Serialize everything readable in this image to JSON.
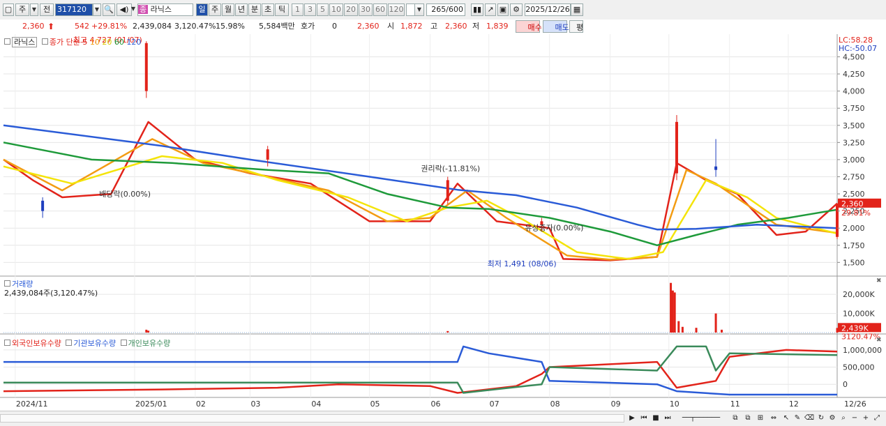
{
  "toolbar": {
    "period_tabs": [
      "주",
      "전"
    ],
    "code": "317120",
    "stock_badge": "종",
    "stock_name": "라닉스",
    "periods": [
      "일",
      "주",
      "월",
      "년",
      "분",
      "초",
      "틱"
    ],
    "active_period": "일",
    "minute_options": [
      "1",
      "3",
      "5",
      "10",
      "20",
      "30",
      "60",
      "120"
    ],
    "count": "265",
    "count_total": "/600",
    "date": "2025/12/26"
  },
  "price_row": {
    "price": "2,360",
    "change": "542",
    "change_pct": "+29.81%",
    "volume": "2,439,084",
    "volume_pct": "3,120.47%",
    "turnover": "15.98%",
    "amount": "5,584백만",
    "quote_label": "호가",
    "quote_value": "0",
    "quote_price": "2,360",
    "open_label": "시",
    "open": "1,872",
    "high_label": "고",
    "high": "2,360",
    "low_label": "저",
    "low": "1,839",
    "buy_label": "매수",
    "sell_label": "매도",
    "extra_label": "평"
  },
  "legend": {
    "stock_name": "라닉스",
    "price_type": "종가 단순",
    "ma_periods": [
      "5",
      "10",
      "20",
      "60",
      "120"
    ],
    "ma_colors": [
      "#e2231a",
      "#f39c12",
      "#f4e40a",
      "#1e9a3a",
      "#2a5bd7"
    ]
  },
  "chart_data": [
    {
      "type": "line",
      "title": "",
      "y_ticks": [
        "4,500",
        "4,250",
        "4,000",
        "3,750",
        "3,500",
        "3,250",
        "3,000",
        "2,750",
        "2,500",
        "2,250",
        "2,000",
        "1,750",
        "1,500"
      ],
      "ylim": [
        1300,
        4800
      ],
      "x_ticks": [
        "2024/11",
        "2025/01",
        "02",
        "03",
        "04",
        "05",
        "06",
        "07",
        "08",
        "09",
        "10",
        "11",
        "12",
        "12/26"
      ],
      "top_right_labels": [
        "LC:58.28",
        "HC:-50.07"
      ],
      "last_price_label": "2,360",
      "last_change_label": "29.81%",
      "annotations": [
        {
          "text": "최고 4,727 (01/07)",
          "x": "2025/01/07",
          "y": 4727
        },
        {
          "text": "배당락(0.00%)",
          "x": "2024/12/26",
          "y": 2380
        },
        {
          "text": "권리락(-11.81%)",
          "x": "2025/06/10",
          "y": 2750
        },
        {
          "text": "유상증자(0.00%)",
          "x": "2025/07/28",
          "y": 2050
        },
        {
          "text": "최저 1,491 (08/06)",
          "x": "2025/08/06",
          "y": 1491
        }
      ],
      "series": [
        {
          "name": "5",
          "color": "#e2231a",
          "points": [
            [
              "2024-10-26",
              3000
            ],
            [
              "2024-11-10",
              2700
            ],
            [
              "2024-11-25",
              2450
            ],
            [
              "2024-12-20",
              2500
            ],
            [
              "2025-01-08",
              3550
            ],
            [
              "2025-02-01",
              3000
            ],
            [
              "2025-03-01",
              2800
            ],
            [
              "2025-04-01",
              2650
            ],
            [
              "2025-05-01",
              2100
            ],
            [
              "2025-06-01",
              2100
            ],
            [
              "2025-06-15",
              2650
            ],
            [
              "2025-07-05",
              2100
            ],
            [
              "2025-08-01",
              2000
            ],
            [
              "2025-08-08",
              1550
            ],
            [
              "2025-09-01",
              1530
            ],
            [
              "2025-09-25",
              1580
            ],
            [
              "2025-10-05",
              2950
            ],
            [
              "2025-10-20",
              2700
            ],
            [
              "2025-11-05",
              2500
            ],
            [
              "2025-11-25",
              1900
            ],
            [
              "2025-12-10",
              1950
            ],
            [
              "2025-12-26",
              2360
            ]
          ]
        },
        {
          "name": "10",
          "color": "#f39c12",
          "points": [
            [
              "2024-10-26",
              3000
            ],
            [
              "2024-11-25",
              2550
            ],
            [
              "2025-01-10",
              3300
            ],
            [
              "2025-02-05",
              2950
            ],
            [
              "2025-03-10",
              2750
            ],
            [
              "2025-04-10",
              2550
            ],
            [
              "2025-05-10",
              2100
            ],
            [
              "2025-06-01",
              2150
            ],
            [
              "2025-06-20",
              2550
            ],
            [
              "2025-07-10",
              2150
            ],
            [
              "2025-08-10",
              1600
            ],
            [
              "2025-09-01",
              1540
            ],
            [
              "2025-09-25",
              1580
            ],
            [
              "2025-10-10",
              2850
            ],
            [
              "2025-10-25",
              2650
            ],
            [
              "2025-11-25",
              2050
            ],
            [
              "2025-12-26",
              1930
            ]
          ]
        },
        {
          "name": "20",
          "color": "#f4e40a",
          "points": [
            [
              "2024-10-26",
              2900
            ],
            [
              "2024-11-30",
              2650
            ],
            [
              "2025-01-15",
              3050
            ],
            [
              "2025-02-15",
              2950
            ],
            [
              "2025-03-15",
              2700
            ],
            [
              "2025-04-20",
              2450
            ],
            [
              "2025-05-20",
              2100
            ],
            [
              "2025-06-10",
              2300
            ],
            [
              "2025-06-30",
              2400
            ],
            [
              "2025-07-20",
              2100
            ],
            [
              "2025-08-15",
              1650
            ],
            [
              "2025-09-10",
              1550
            ],
            [
              "2025-09-28",
              1650
            ],
            [
              "2025-10-20",
              2700
            ],
            [
              "2025-11-10",
              2450
            ],
            [
              "2025-11-25",
              2150
            ],
            [
              "2025-12-26",
              1920
            ]
          ]
        },
        {
          "name": "60",
          "color": "#1e9a3a",
          "points": [
            [
              "2024-10-26",
              3250
            ],
            [
              "2024-12-10",
              3000
            ],
            [
              "2025-01-20",
              2950
            ],
            [
              "2025-03-10",
              2850
            ],
            [
              "2025-04-10",
              2800
            ],
            [
              "2025-05-10",
              2500
            ],
            [
              "2025-06-10",
              2300
            ],
            [
              "2025-07-01",
              2280
            ],
            [
              "2025-08-01",
              2150
            ],
            [
              "2025-09-01",
              1950
            ],
            [
              "2025-09-25",
              1750
            ],
            [
              "2025-10-15",
              1900
            ],
            [
              "2025-11-05",
              2050
            ],
            [
              "2025-12-01",
              2150
            ],
            [
              "2025-12-26",
              2270
            ]
          ]
        },
        {
          "name": "120",
          "color": "#2a5bd7",
          "points": [
            [
              "2024-10-26",
              3500
            ],
            [
              "2025-01-15",
              3200
            ],
            [
              "2025-03-01",
              3000
            ],
            [
              "2025-05-01",
              2750
            ],
            [
              "2025-06-15",
              2560
            ],
            [
              "2025-07-15",
              2480
            ],
            [
              "2025-08-15",
              2300
            ],
            [
              "2025-09-15",
              2050
            ],
            [
              "2025-09-25",
              1980
            ],
            [
              "2025-10-15",
              1990
            ],
            [
              "2025-11-15",
              2050
            ],
            [
              "2025-12-26",
              2000
            ]
          ]
        }
      ],
      "candles": [
        [
          "2024-11-15",
          2400,
          2250,
          2450,
          2150
        ],
        [
          "2025-01-07",
          4000,
          4700,
          4727,
          3900
        ],
        [
          "2025-03-10",
          3000,
          3150,
          3200,
          2900
        ],
        [
          "2025-06-10",
          2400,
          2700,
          2750,
          2350
        ],
        [
          "2025-07-28",
          2050,
          2100,
          2150,
          1950
        ],
        [
          "2025-10-05",
          2800,
          3550,
          3650,
          2700
        ],
        [
          "2025-10-25",
          2900,
          2850,
          3300,
          2750
        ],
        [
          "2025-12-26",
          1872,
          2360,
          2360,
          1839
        ]
      ]
    },
    {
      "type": "bar",
      "title": "거래량",
      "subtitle": "2,439,084주(3,120.47%)",
      "y_ticks": [
        "20,000K",
        "10,000K"
      ],
      "last_label": "2,439K",
      "last_pct_label": "3120.47%",
      "ylim": [
        0,
        27000
      ],
      "bars": [
        [
          "2025-01-07",
          1500
        ],
        [
          "2025-01-08",
          1000
        ],
        [
          "2025-06-10",
          800
        ],
        [
          "2025-10-02",
          26000
        ],
        [
          "2025-10-03",
          22000
        ],
        [
          "2025-10-04",
          21000
        ],
        [
          "2025-10-06",
          6000
        ],
        [
          "2025-10-08",
          3000
        ],
        [
          "2025-10-15",
          2500
        ],
        [
          "2025-10-25",
          10000
        ],
        [
          "2025-10-28",
          1500
        ],
        [
          "2025-12-26",
          2439
        ]
      ]
    },
    {
      "type": "line",
      "title": "",
      "legend": [
        "외국인보유수량",
        "기관보유수량",
        "개인보유수량"
      ],
      "y_ticks": [
        "1,000,000",
        "500,000",
        "0"
      ],
      "ylim": [
        -300000,
        1200000
      ],
      "series": [
        {
          "name": "외국인보유수량",
          "color": "#e2231a",
          "points": [
            [
              "2024-10-26",
              -200000
            ],
            [
              "2025-01-15",
              -150000
            ],
            [
              "2025-03-15",
              -100000
            ],
            [
              "2025-04-15",
              0
            ],
            [
              "2025-06-01",
              -50000
            ],
            [
              "2025-06-15",
              -250000
            ],
            [
              "2025-07-15",
              -50000
            ],
            [
              "2025-07-28",
              300000
            ],
            [
              "2025-08-01",
              500000
            ],
            [
              "2025-09-25",
              650000
            ],
            [
              "2025-10-05",
              -100000
            ],
            [
              "2025-10-25",
              100000
            ],
            [
              "2025-11-01",
              800000
            ],
            [
              "2025-11-30",
              1000000
            ],
            [
              "2025-12-26",
              950000
            ]
          ]
        },
        {
          "name": "기관보유수량",
          "color": "#2a5bd7",
          "points": [
            [
              "2024-10-26",
              650000
            ],
            [
              "2025-06-15",
              650000
            ],
            [
              "2025-06-18",
              1100000
            ],
            [
              "2025-07-01",
              900000
            ],
            [
              "2025-07-28",
              650000
            ],
            [
              "2025-08-01",
              100000
            ],
            [
              "2025-09-25",
              0
            ],
            [
              "2025-10-05",
              -200000
            ],
            [
              "2025-11-01",
              -300000
            ],
            [
              "2025-12-26",
              -300000
            ]
          ]
        },
        {
          "name": "개인보유수량",
          "color": "#3a8a5a",
          "points": [
            [
              "2024-10-26",
              50000
            ],
            [
              "2025-06-15",
              50000
            ],
            [
              "2025-06-18",
              -250000
            ],
            [
              "2025-07-28",
              0
            ],
            [
              "2025-08-01",
              500000
            ],
            [
              "2025-09-25",
              400000
            ],
            [
              "2025-10-05",
              1100000
            ],
            [
              "2025-10-20",
              1100000
            ],
            [
              "2025-10-25",
              400000
            ],
            [
              "2025-11-01",
              900000
            ],
            [
              "2025-12-26",
              850000
            ]
          ]
        }
      ]
    }
  ]
}
